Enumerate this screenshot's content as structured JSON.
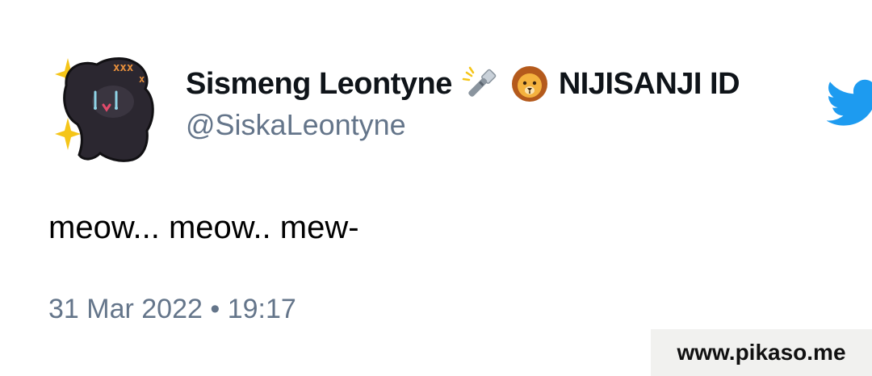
{
  "tweet": {
    "display_name": "Sismeng Leontyne",
    "name_emoji_1": "flashlight-emoji",
    "name_emoji_2": "lion-face-emoji",
    "org": "NIJISANJI ID",
    "handle": "@SiskaLeontyne",
    "text": "meow... meow.. mew-",
    "timestamp": "31 Mar 2022 • 19:17"
  },
  "brand": {
    "logo": "twitter-bird-icon",
    "color": "#1d9bf0"
  },
  "watermark": {
    "text": "www.pikaso.me"
  },
  "colors": {
    "name": "#0f1419",
    "secondary": "#64758a",
    "watermark_bg": "#f1f1ef"
  }
}
